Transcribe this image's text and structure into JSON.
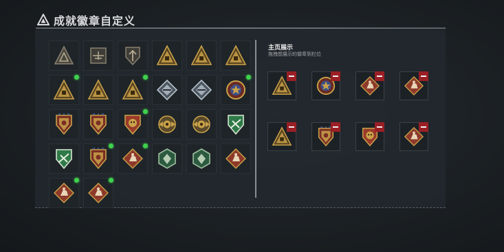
{
  "header": {
    "title": "成就徽章自定义"
  },
  "collection": {
    "badges": [
      {
        "icon": "triangle-eye-badge",
        "new": false,
        "style": "dim-triangle"
      },
      {
        "icon": "helicopter-badge",
        "new": false,
        "style": "dim-square"
      },
      {
        "icon": "arrow-shield-badge",
        "new": false,
        "style": "dim-shield"
      },
      {
        "icon": "vehicle-triangle-badge",
        "new": false,
        "style": "gold-triangle"
      },
      {
        "icon": "hand-triangle-badge",
        "new": false,
        "style": "gold-triangle"
      },
      {
        "icon": "number-one-triangle-badge",
        "new": false,
        "style": "gold-triangle"
      },
      {
        "icon": "crate-triangle-badge",
        "new": true,
        "style": "gold-triangle"
      },
      {
        "icon": "squad-triangle-badge",
        "new": false,
        "style": "gold-triangle"
      },
      {
        "icon": "soldiers-triangle-badge",
        "new": true,
        "style": "gold-triangle"
      },
      {
        "icon": "silver-diamond-badge",
        "new": false,
        "style": "silver-diamond"
      },
      {
        "icon": "rifle-diamond-badge",
        "new": false,
        "style": "silver-diamond"
      },
      {
        "icon": "star-medal-badge",
        "new": true,
        "style": "gold-medal"
      },
      {
        "icon": "wings-shield-badge",
        "new": false,
        "style": "gold-shield"
      },
      {
        "icon": "grenade-shield-badge",
        "new": false,
        "style": "gold-shield"
      },
      {
        "icon": "skull-shield-badge",
        "new": true,
        "style": "red-shield"
      },
      {
        "icon": "wings-globe-badge",
        "new": false,
        "style": "gold-round"
      },
      {
        "icon": "eye-globe-badge",
        "new": false,
        "style": "gold-round"
      },
      {
        "icon": "feather-shield-badge",
        "new": false,
        "style": "green-shield"
      },
      {
        "icon": "cross-shield-badge",
        "new": false,
        "style": "green-shield"
      },
      {
        "icon": "eagle-shield-badge",
        "new": true,
        "style": "gold-shield"
      },
      {
        "icon": "runner-diamond-badge",
        "new": true,
        "style": "red-diamond"
      },
      {
        "icon": "gun-hexagon-badge",
        "new": false,
        "style": "green-hexagon"
      },
      {
        "icon": "soldier-hexagon-badge",
        "new": false,
        "style": "green-hexagon"
      },
      {
        "icon": "beast-diamond-badge",
        "new": false,
        "style": "red-diamond"
      },
      {
        "icon": "dog-diamond-badge",
        "new": true,
        "style": "red-diamond"
      },
      {
        "icon": "crouch-diamond-badge",
        "new": true,
        "style": "red-diamond"
      }
    ]
  },
  "homepage": {
    "title": "主页展示",
    "subtitle": "拖拽想展示的徽章到栏位",
    "slots": [
      {
        "icon": "crate-triangle-badge",
        "style": "gold-triangle"
      },
      {
        "icon": "star-medal-badge",
        "style": "gold-medal"
      },
      {
        "icon": "runner-diamond-badge",
        "style": "red-diamond"
      },
      {
        "icon": "dog-diamond-badge",
        "style": "red-diamond"
      },
      {
        "icon": "soldiers-triangle-badge",
        "style": "gold-triangle"
      },
      {
        "icon": "eagle-shield-badge",
        "style": "gold-shield"
      },
      {
        "icon": "skull-shield-badge",
        "style": "red-shield"
      },
      {
        "icon": "crouch-diamond-badge",
        "style": "red-diamond"
      }
    ]
  },
  "colors": {
    "gold": "#c9a24a",
    "red": "#8e3a2a",
    "green": "#2f7a48",
    "silver": "#b8c2cc",
    "new_dot": "#3fd14d",
    "remove": "#9a1f25"
  }
}
